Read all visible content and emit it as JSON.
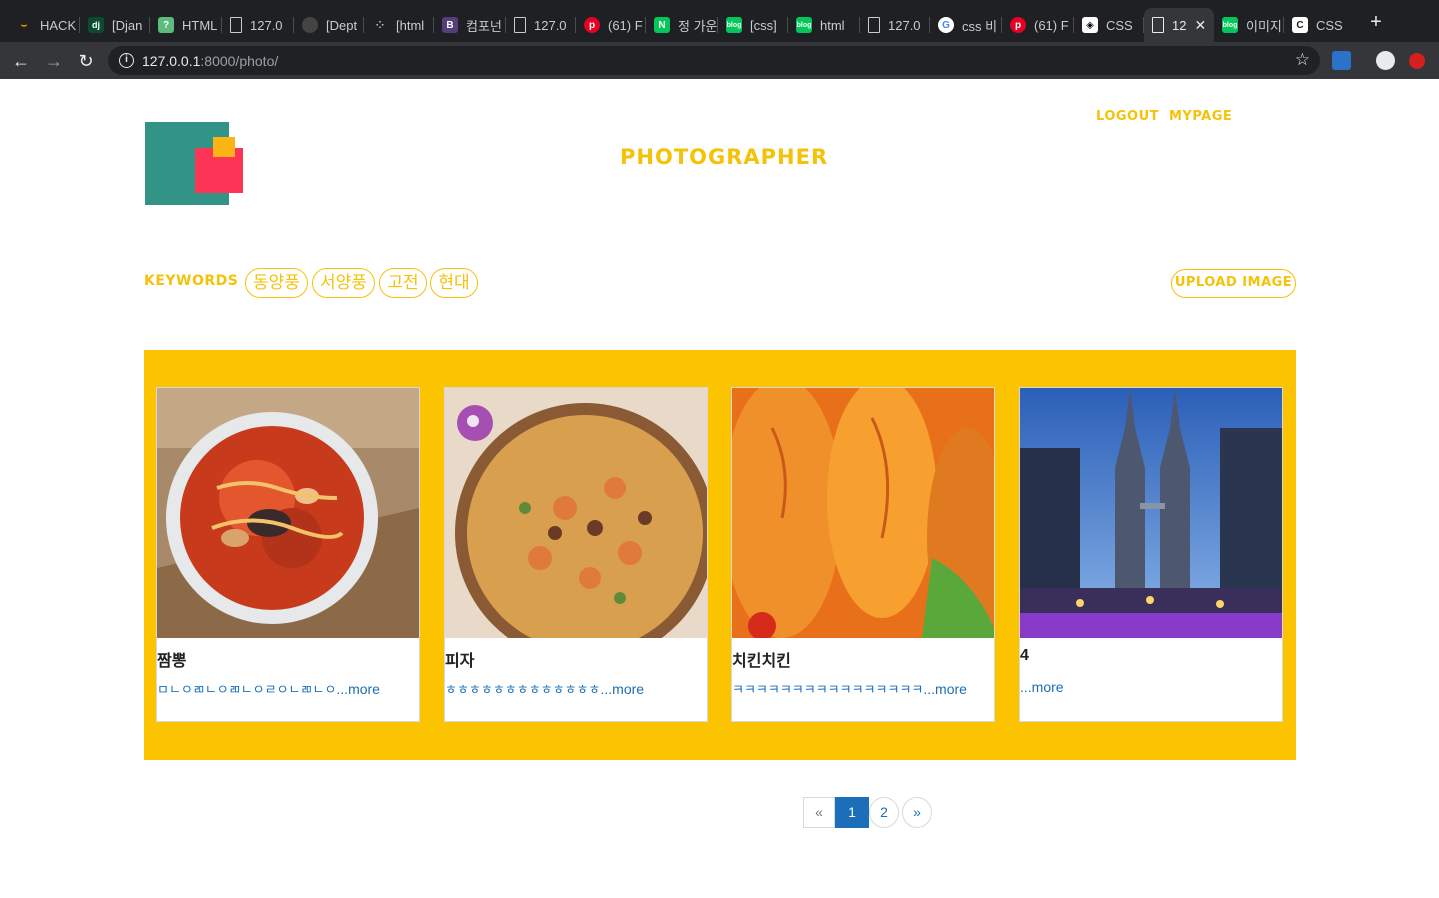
{
  "browser": {
    "tabs": [
      {
        "label": "HACK",
        "icon": "amazon-icon"
      },
      {
        "label": "[Djan",
        "icon": "django-icon"
      },
      {
        "label": "HTML",
        "icon": "question-icon"
      },
      {
        "label": "127.0",
        "icon": "page-icon"
      },
      {
        "label": "[Dept",
        "icon": "github-icon"
      },
      {
        "label": "[html",
        "icon": "dots-icon"
      },
      {
        "label": "컴포넌",
        "icon": "bootstrap-icon"
      },
      {
        "label": "127.0",
        "icon": "page-icon"
      },
      {
        "label": "(61) F",
        "icon": "pinterest-icon"
      },
      {
        "label": "정 가운",
        "icon": "naver-icon"
      },
      {
        "label": "[css]",
        "icon": "blog-icon"
      },
      {
        "label": "html",
        "icon": "blog-icon"
      },
      {
        "label": "127.0",
        "icon": "page-icon"
      },
      {
        "label": "css 비",
        "icon": "google-icon"
      },
      {
        "label": "(61) F",
        "icon": "pinterest-icon"
      },
      {
        "label": "CSS",
        "icon": "codepen-icon"
      },
      {
        "label": "12",
        "icon": "page-icon"
      },
      {
        "label": "이미지",
        "icon": "blog-icon"
      },
      {
        "label": "CSS",
        "icon": "css-icon"
      }
    ],
    "url_host": "127.0.0.1",
    "url_path": ":8000/photo/"
  },
  "header": {
    "title": "PHOTOGRAPHER",
    "logout": "LOGOUT",
    "mypage": "MYPAGE"
  },
  "keywords": {
    "label": "KEYWORDS",
    "items": [
      "동양풍",
      "서양풍",
      "고전",
      "현대"
    ],
    "upload": "UPLOAD IMAGE"
  },
  "cards": [
    {
      "title": "짬뽕",
      "desc": "ㅁㄴㅇㄻㄴㅇㄻㄴㅇㄹㅇㄴㄻㄴㅇ",
      "more": "...more",
      "image": "noodle-soup"
    },
    {
      "title": "피자",
      "desc": "ㅎㅎㅎㅎㅎㅎㅎㅎㅎㅎㅎㅎㅎ",
      "more": "...more",
      "image": "pizza"
    },
    {
      "title": "치킨치킨",
      "desc": "ㅋㅋㅋㅋㅋㅋㅋㅋㅋㅋㅋㅋㅋㅋㅋㅋ",
      "more": "...more",
      "image": "fried-chicken"
    },
    {
      "title": "4",
      "desc": "",
      "more": "...more",
      "image": "city-towers"
    }
  ],
  "pagination": {
    "prev": "«",
    "pages": [
      "1",
      "2"
    ],
    "next": "»",
    "current": "1"
  },
  "colors": {
    "accent": "#f5c20a",
    "gallery_bg": "#fcc400",
    "link": "#1a6fb8"
  }
}
